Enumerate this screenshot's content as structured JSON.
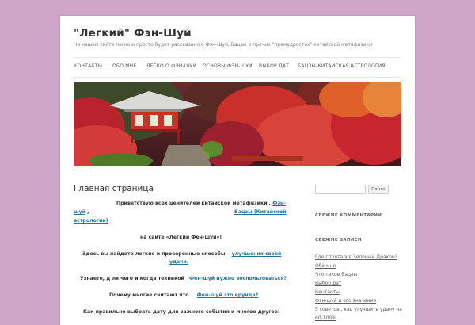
{
  "site": {
    "title": "\"Легкий\" Фэн-Шуй",
    "description": "На нашем сайте легко и просто будет рассказано о Фэн-Шуй, Бацзы и прочих \"премудростях\" китайской метафизики"
  },
  "nav": {
    "items": [
      "Контакты",
      "Обо мне",
      "Легко о Фэн-Шуй",
      "Основы Фэн-Шуй",
      "Выбор дат",
      "Бацзы-китайская астрология"
    ]
  },
  "banner": {
    "alt_icon": "pagoda-garden-image"
  },
  "entry": {
    "title": "Главная  страница",
    "line1_text": "Приветствую всех ценителей китайской метафизики ,",
    "line1_link": "Фэн-",
    "line2_link_a": "шуй",
    "line2_sep": ",",
    "line2_link_b": "Бацзы  (Китайской",
    "line3_link": "астрологии)",
    "line4_text": "на сайте «Легкий Фен-шуй»!",
    "line5_text": "Здесь вы найдете легкие и проверенные способы",
    "line5_link": "улучшения своей",
    "line6_link": "удачи.",
    "line7_text": "Узнаете,  д ля чего и когда техникой",
    "line7_link": "Фен-шуй нужно воспользоваться?",
    "line8_text": "Почему многие считают что",
    "line8_link": "Фен-шуй это ерунда?",
    "line9_text": "Как правильно выбрать дату для важного события и многое другое!"
  },
  "sidebar": {
    "search_button": "Поиск",
    "search_value": "",
    "recent_comments_title": "Свежие комментарии",
    "recent_posts_title": "Свежие записи",
    "recent_posts": [
      "Где спрятался Зеленый Дракон?",
      "Обо мне",
      "Что такое  Бацзы",
      "Выбор дат",
      "Контакты",
      "Фэн-шуй и его значение",
      "5 советов , как улучшить удачу на",
      "60-100%"
    ]
  },
  "colors": {
    "background": "#cfa6c8",
    "link": "#21759b",
    "text": "#333333"
  }
}
